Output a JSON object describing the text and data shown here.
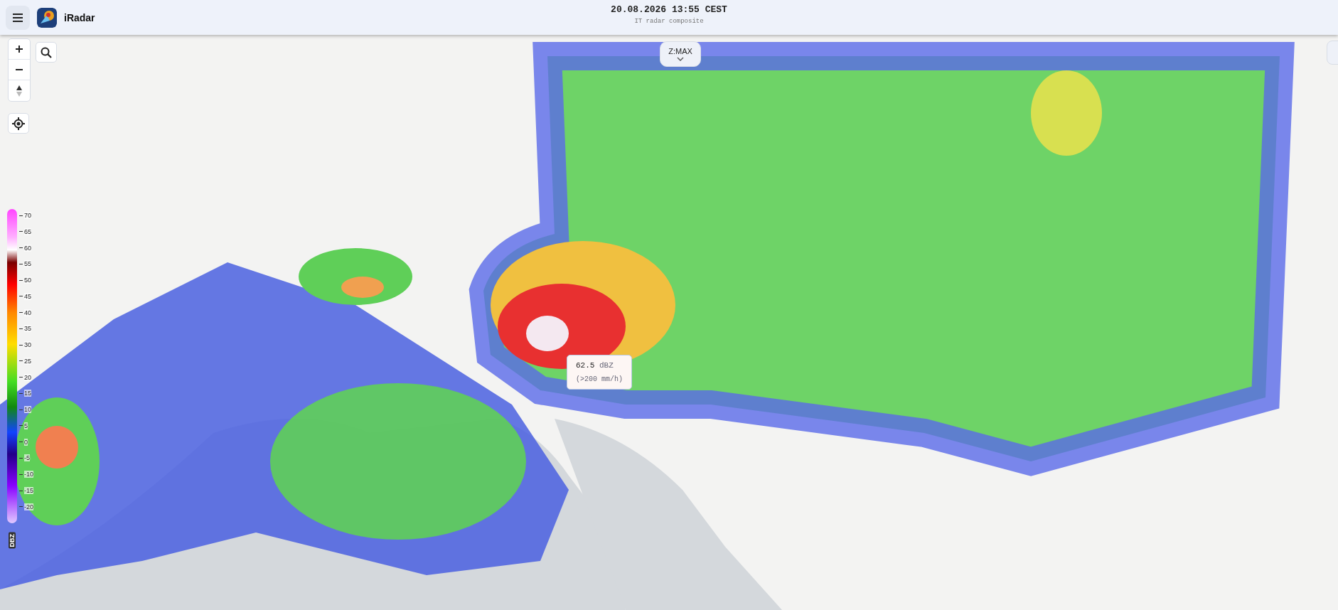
{
  "header": {
    "app_name": "iRadar",
    "datetime": "20.08.2026 13:55 CEST",
    "subtitle": "IT radar composite"
  },
  "map_controls": {
    "level_button": {
      "label": "Z:MAX"
    }
  },
  "legend": {
    "unit": "DBZ",
    "ticks": [
      "70",
      "65",
      "60",
      "55",
      "50",
      "45",
      "40",
      "35",
      "30",
      "25",
      "20",
      "15",
      "10",
      "5",
      "0",
      "-5",
      "-10",
      "-15",
      "-20"
    ]
  },
  "tooltip": {
    "value": "62.5",
    "unit": "dBZ",
    "rate": "(>200 mm/h)"
  }
}
